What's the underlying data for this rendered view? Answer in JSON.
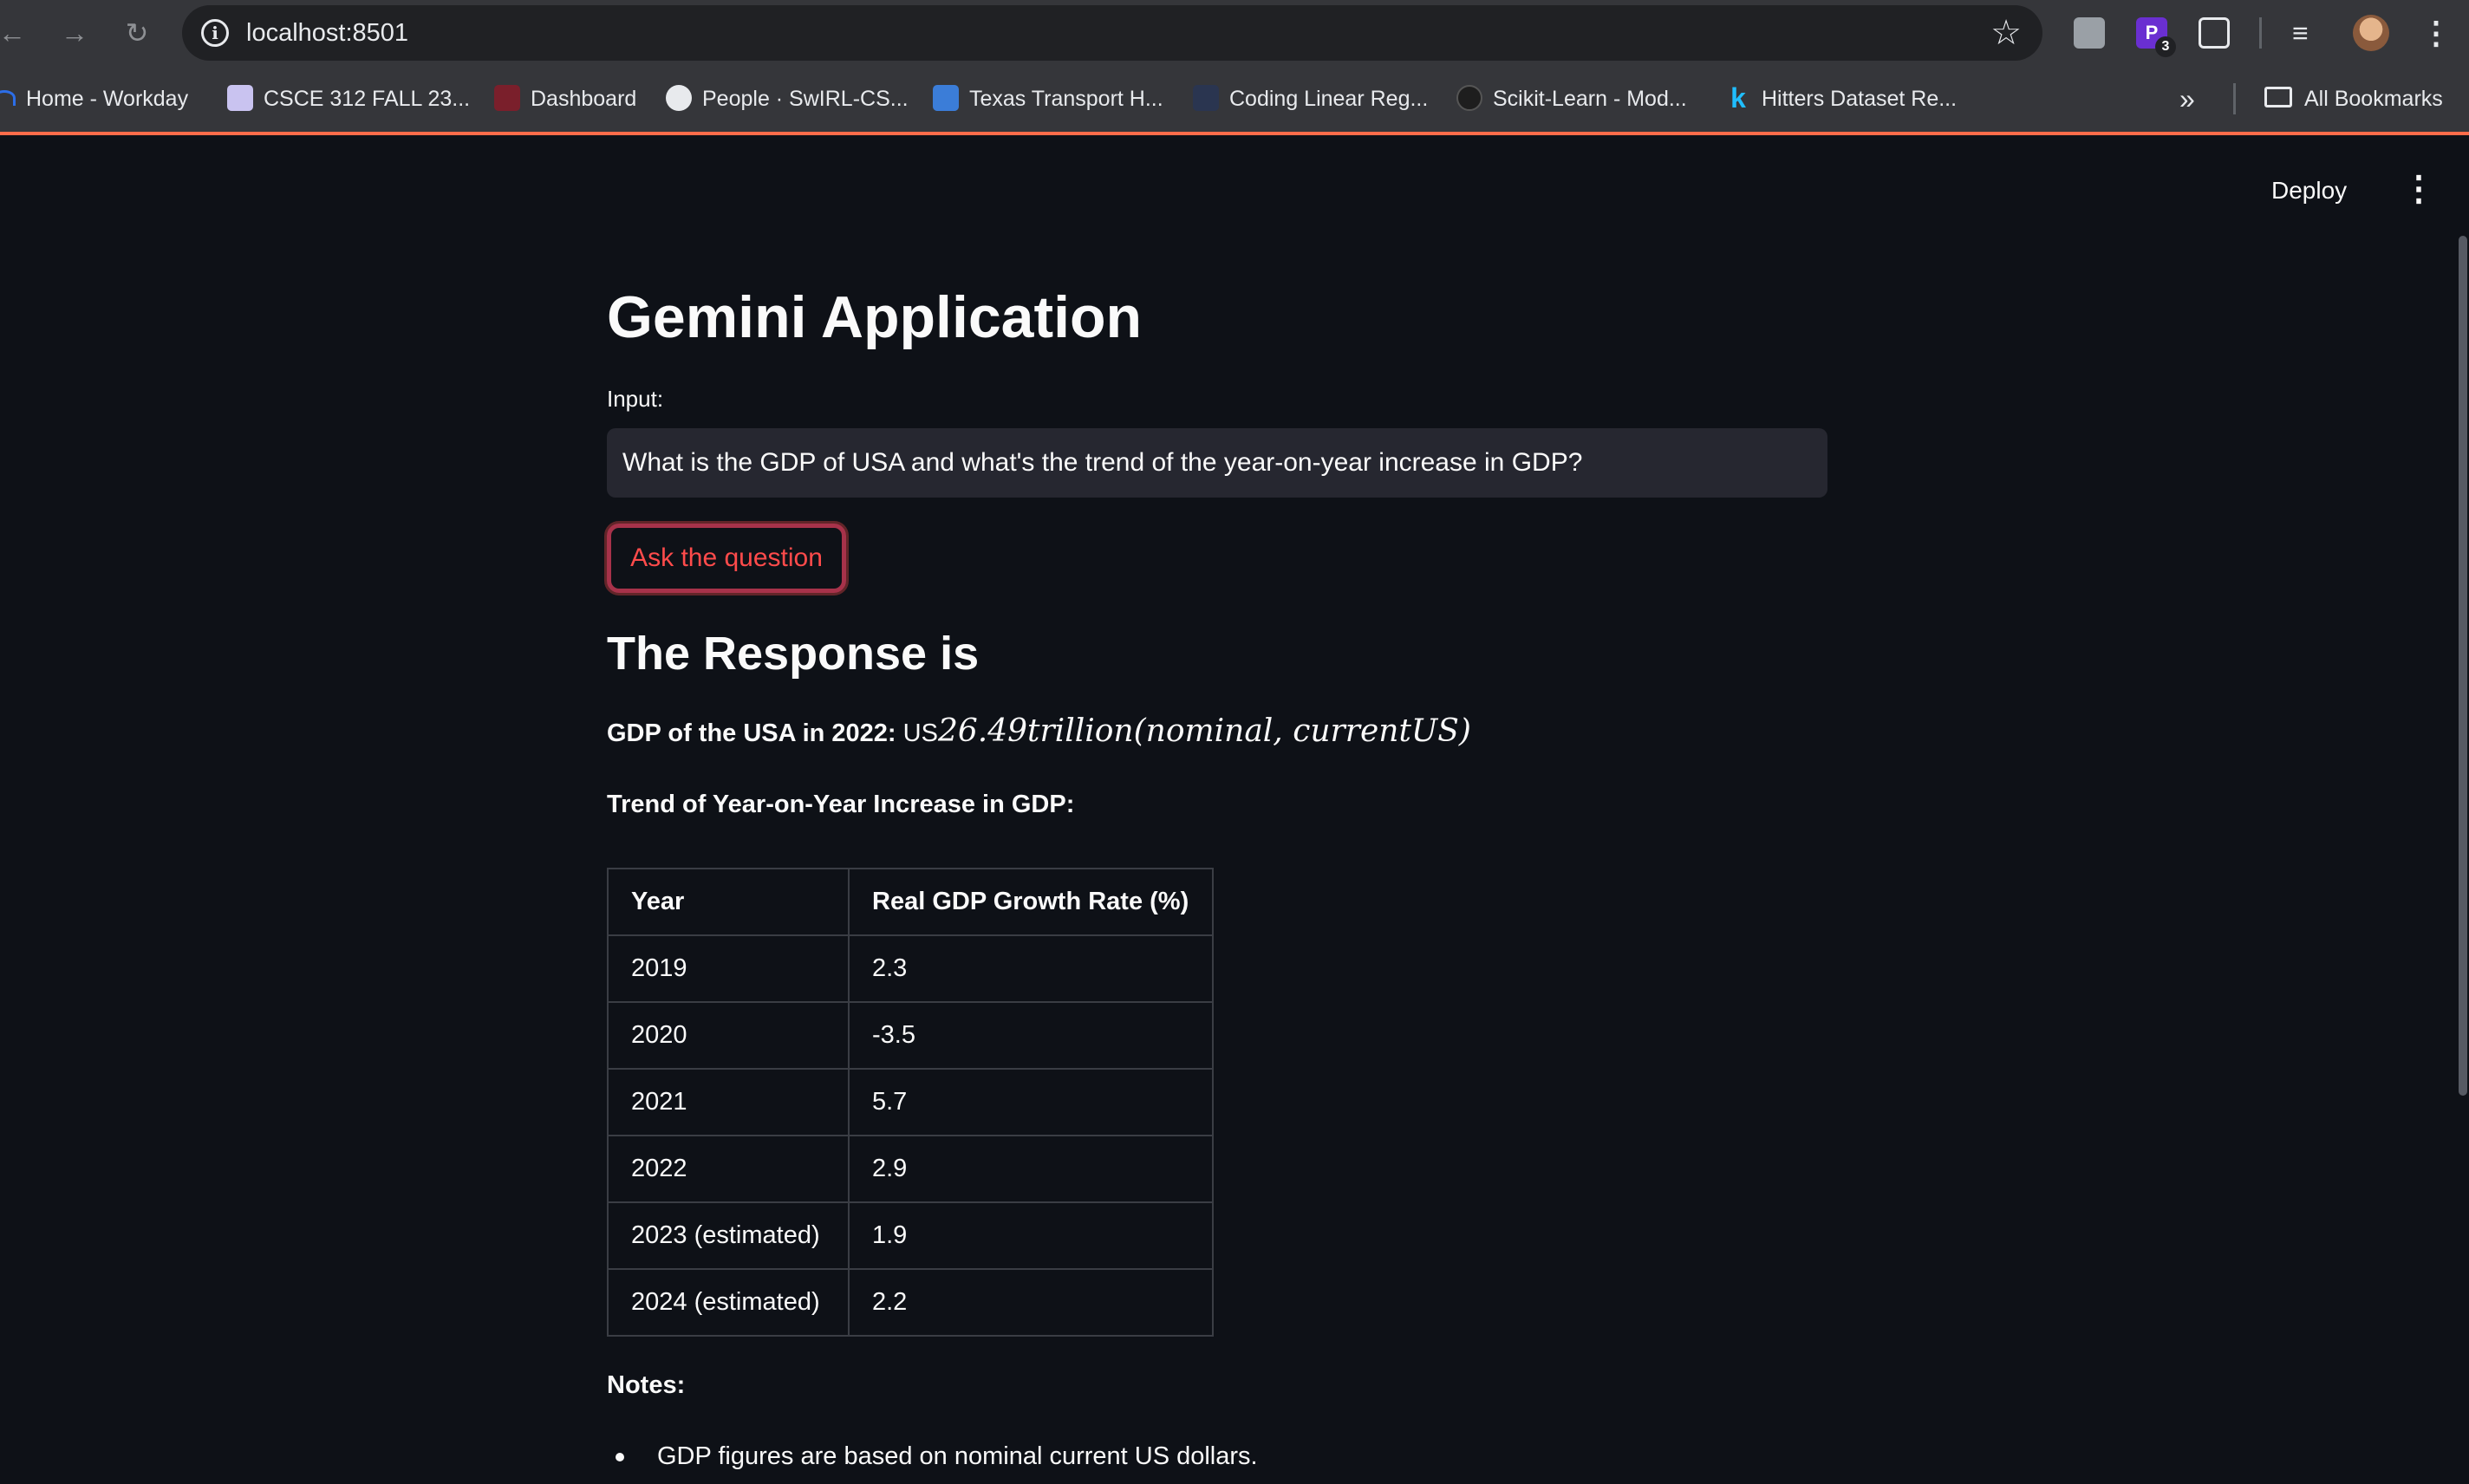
{
  "browser": {
    "url": "localhost:8501",
    "bookmarks": [
      {
        "label": "Home - Workday",
        "color": "#2c6ee8"
      },
      {
        "label": "CSCE 312 FALL 23...",
        "color": "#c9c3f0"
      },
      {
        "label": "Dashboard",
        "color": "#7a1f2b"
      },
      {
        "label": "People · SwIRL-CS...",
        "color": "#e8eaed"
      },
      {
        "label": "Texas Transport H...",
        "color": "#3b7dd8"
      },
      {
        "label": "Coding Linear Reg...",
        "color": "#2a3550"
      },
      {
        "label": "Scikit-Learn - Mod...",
        "color": "#1e1e1e"
      },
      {
        "label": "Hitters Dataset Re...",
        "color": "#20beff"
      }
    ],
    "all_bookmarks": "All Bookmarks",
    "extension_badge": "3",
    "extension_letter": "P"
  },
  "app": {
    "deploy_label": "Deploy",
    "title": "Gemini Application",
    "input_label": "Input:",
    "input_value": "What is the GDP of USA and what's the trend of the year-on-year increase in GDP?",
    "button_label": "Ask the question",
    "response_heading": "The Response is",
    "gdp_label": "GDP of the USA in 2022:",
    "gdp_prefix": "US",
    "gdp_math": "26.49trillion(nominal, currentUS)",
    "trend_heading": "Trend of Year-on-Year Increase in GDP:",
    "table": {
      "headers": [
        "Year",
        "Real GDP Growth Rate (%)"
      ],
      "rows": [
        [
          "2019",
          "2.3"
        ],
        [
          "2020",
          "-3.5"
        ],
        [
          "2021",
          "5.7"
        ],
        [
          "2022",
          "2.9"
        ],
        [
          "2023 (estimated)",
          "1.9"
        ],
        [
          "2024 (estimated)",
          "2.2"
        ]
      ]
    },
    "notes_heading": "Notes:",
    "notes": [
      "GDP figures are based on nominal current US dollars."
    ]
  },
  "colors": {
    "background": "#0e1117",
    "accent": "#ff4b4b",
    "input_bg": "#262730"
  }
}
